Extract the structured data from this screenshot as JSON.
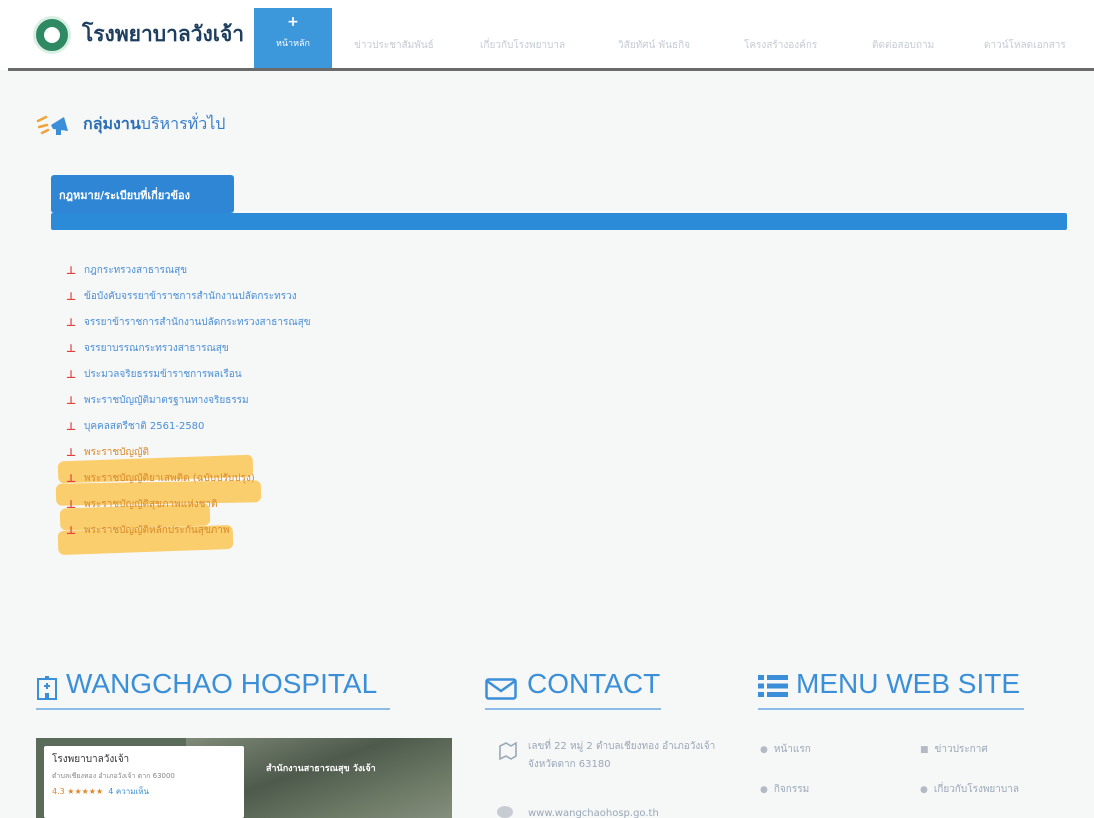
{
  "header": {
    "brand": "โรงพยาบาลวังเจ้า",
    "home_plus": "+",
    "home_label": "หน้าหลัก",
    "nav_items": [
      "ข่าวประชาสัมพันธ์",
      "เกี่ยวกับโรงพยาบาล",
      "วิสัยทัศน์ พันธกิจ",
      "โครงสร้างองค์กร",
      "ติดต่อสอบถาม",
      "ดาวน์โหลดเอกสาร"
    ]
  },
  "section": {
    "title_strong": "กลุ่มงาน",
    "title_light": "บริหารทั่วไป",
    "tab_label": "กฎหมาย/ระเบียบที่เกี่ยวข้อง"
  },
  "files": [
    "กฎกระทรวงสาธารณสุข",
    "ข้อบังคับจรรยาข้าราชการสำนักงานปลัดกระทรวง",
    "จรรยาข้าราชการสำนักงานปลัดกระทรวงสาธารณสุข",
    "จรรยาบรรณกระทรวงสาธารณสุข",
    "ประมวลจริยธรรมข้าราชการพลเรือน",
    "พระราชบัญญัติมาตรฐานทางจริยธรรม",
    "บุคคลสตรีชาติ 2561-2580",
    "พระราชบัญญัติ",
    "พระราชบัญญัติยาเสพติด (ฉบับปรับปรุง)",
    "พระราชบัญญัติสุขภาพแห่งชาติ",
    "พระราชบัญญัติหลักประกันสุขภาพ"
  ],
  "highlight_color": "#fbbf3f",
  "footer": {
    "hospital_heading": "WANGCHAO HOSPITAL",
    "contact_heading": "CONTACT",
    "menu_heading": "MENU WEB SITE",
    "map_card": {
      "name": "โรงพยาบาลวังเจ้า",
      "address": "ตำบลเชียงทอง อำเภอวังเจ้า ตาก 63000",
      "rating": "4.3 ★★★★★",
      "reviews": "4 ความเห็น"
    },
    "map_label": "สำนักงานสาธารณสุข วังเจ้า",
    "contact_address": "เลขที่ 22 หมู่ 2 ตำบลเชียงทอง อำเภอวังเจ้า จังหวัดตาก 63180",
    "contact_web": "www.wangchaohosp.go.th",
    "menu_links": [
      "หน้าแรก",
      "ข่าวประกาศ",
      "กิจกรรม",
      "เกี่ยวกับโรงพยาบาล"
    ]
  }
}
